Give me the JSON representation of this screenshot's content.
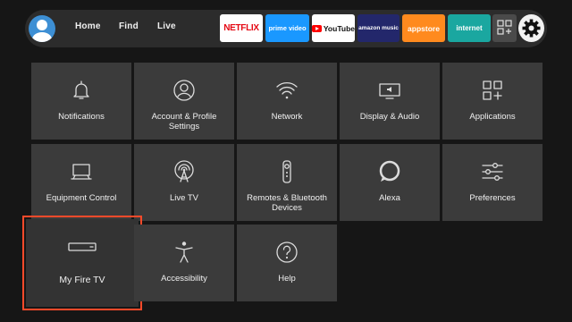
{
  "nav": {
    "links": [
      {
        "label": "Home"
      },
      {
        "label": "Find"
      },
      {
        "label": "Live"
      }
    ],
    "apps": [
      {
        "label": "NETFLIX",
        "icon": "netflix-logo",
        "color": "#e50914"
      },
      {
        "label": "prime video",
        "icon": "prime-video-logo",
        "color": "#1a98ff"
      },
      {
        "label": "YouTube",
        "icon": "youtube-logo",
        "color": "#ff0000"
      },
      {
        "label": "amazon music",
        "icon": "amazon-music-logo",
        "color": "#23276b"
      },
      {
        "label": "appstore",
        "icon": "appstore-logo",
        "color": "#ff8a1e"
      },
      {
        "label": "internet",
        "icon": "internet-logo",
        "color": "#1aa7a0"
      }
    ],
    "apps_grid_icon": "apps-grid-icon",
    "settings_icon": "gear-icon",
    "avatar_icon": "profile-avatar-icon"
  },
  "settings": {
    "tiles": [
      {
        "label": "Notifications",
        "icon": "bell-icon"
      },
      {
        "label": "Account & Profile Settings",
        "icon": "profile-icon"
      },
      {
        "label": "Network",
        "icon": "wifi-icon"
      },
      {
        "label": "Display & Audio",
        "icon": "display-audio-icon"
      },
      {
        "label": "Applications",
        "icon": "applications-icon"
      },
      {
        "label": "Equipment Control",
        "icon": "computer-icon"
      },
      {
        "label": "Live TV",
        "icon": "antenna-icon"
      },
      {
        "label": "Remotes & Bluetooth Devices",
        "icon": "remote-icon"
      },
      {
        "label": "Alexa",
        "icon": "alexa-icon"
      },
      {
        "label": "Preferences",
        "icon": "sliders-icon"
      },
      {
        "label": "My Fire TV",
        "icon": "fire-tv-stick-icon"
      },
      {
        "label": "Accessibility",
        "icon": "accessibility-icon"
      },
      {
        "label": "Help",
        "icon": "help-icon"
      }
    ],
    "focused_tile": "My Fire TV",
    "focus_color": "#ff4a2a"
  }
}
